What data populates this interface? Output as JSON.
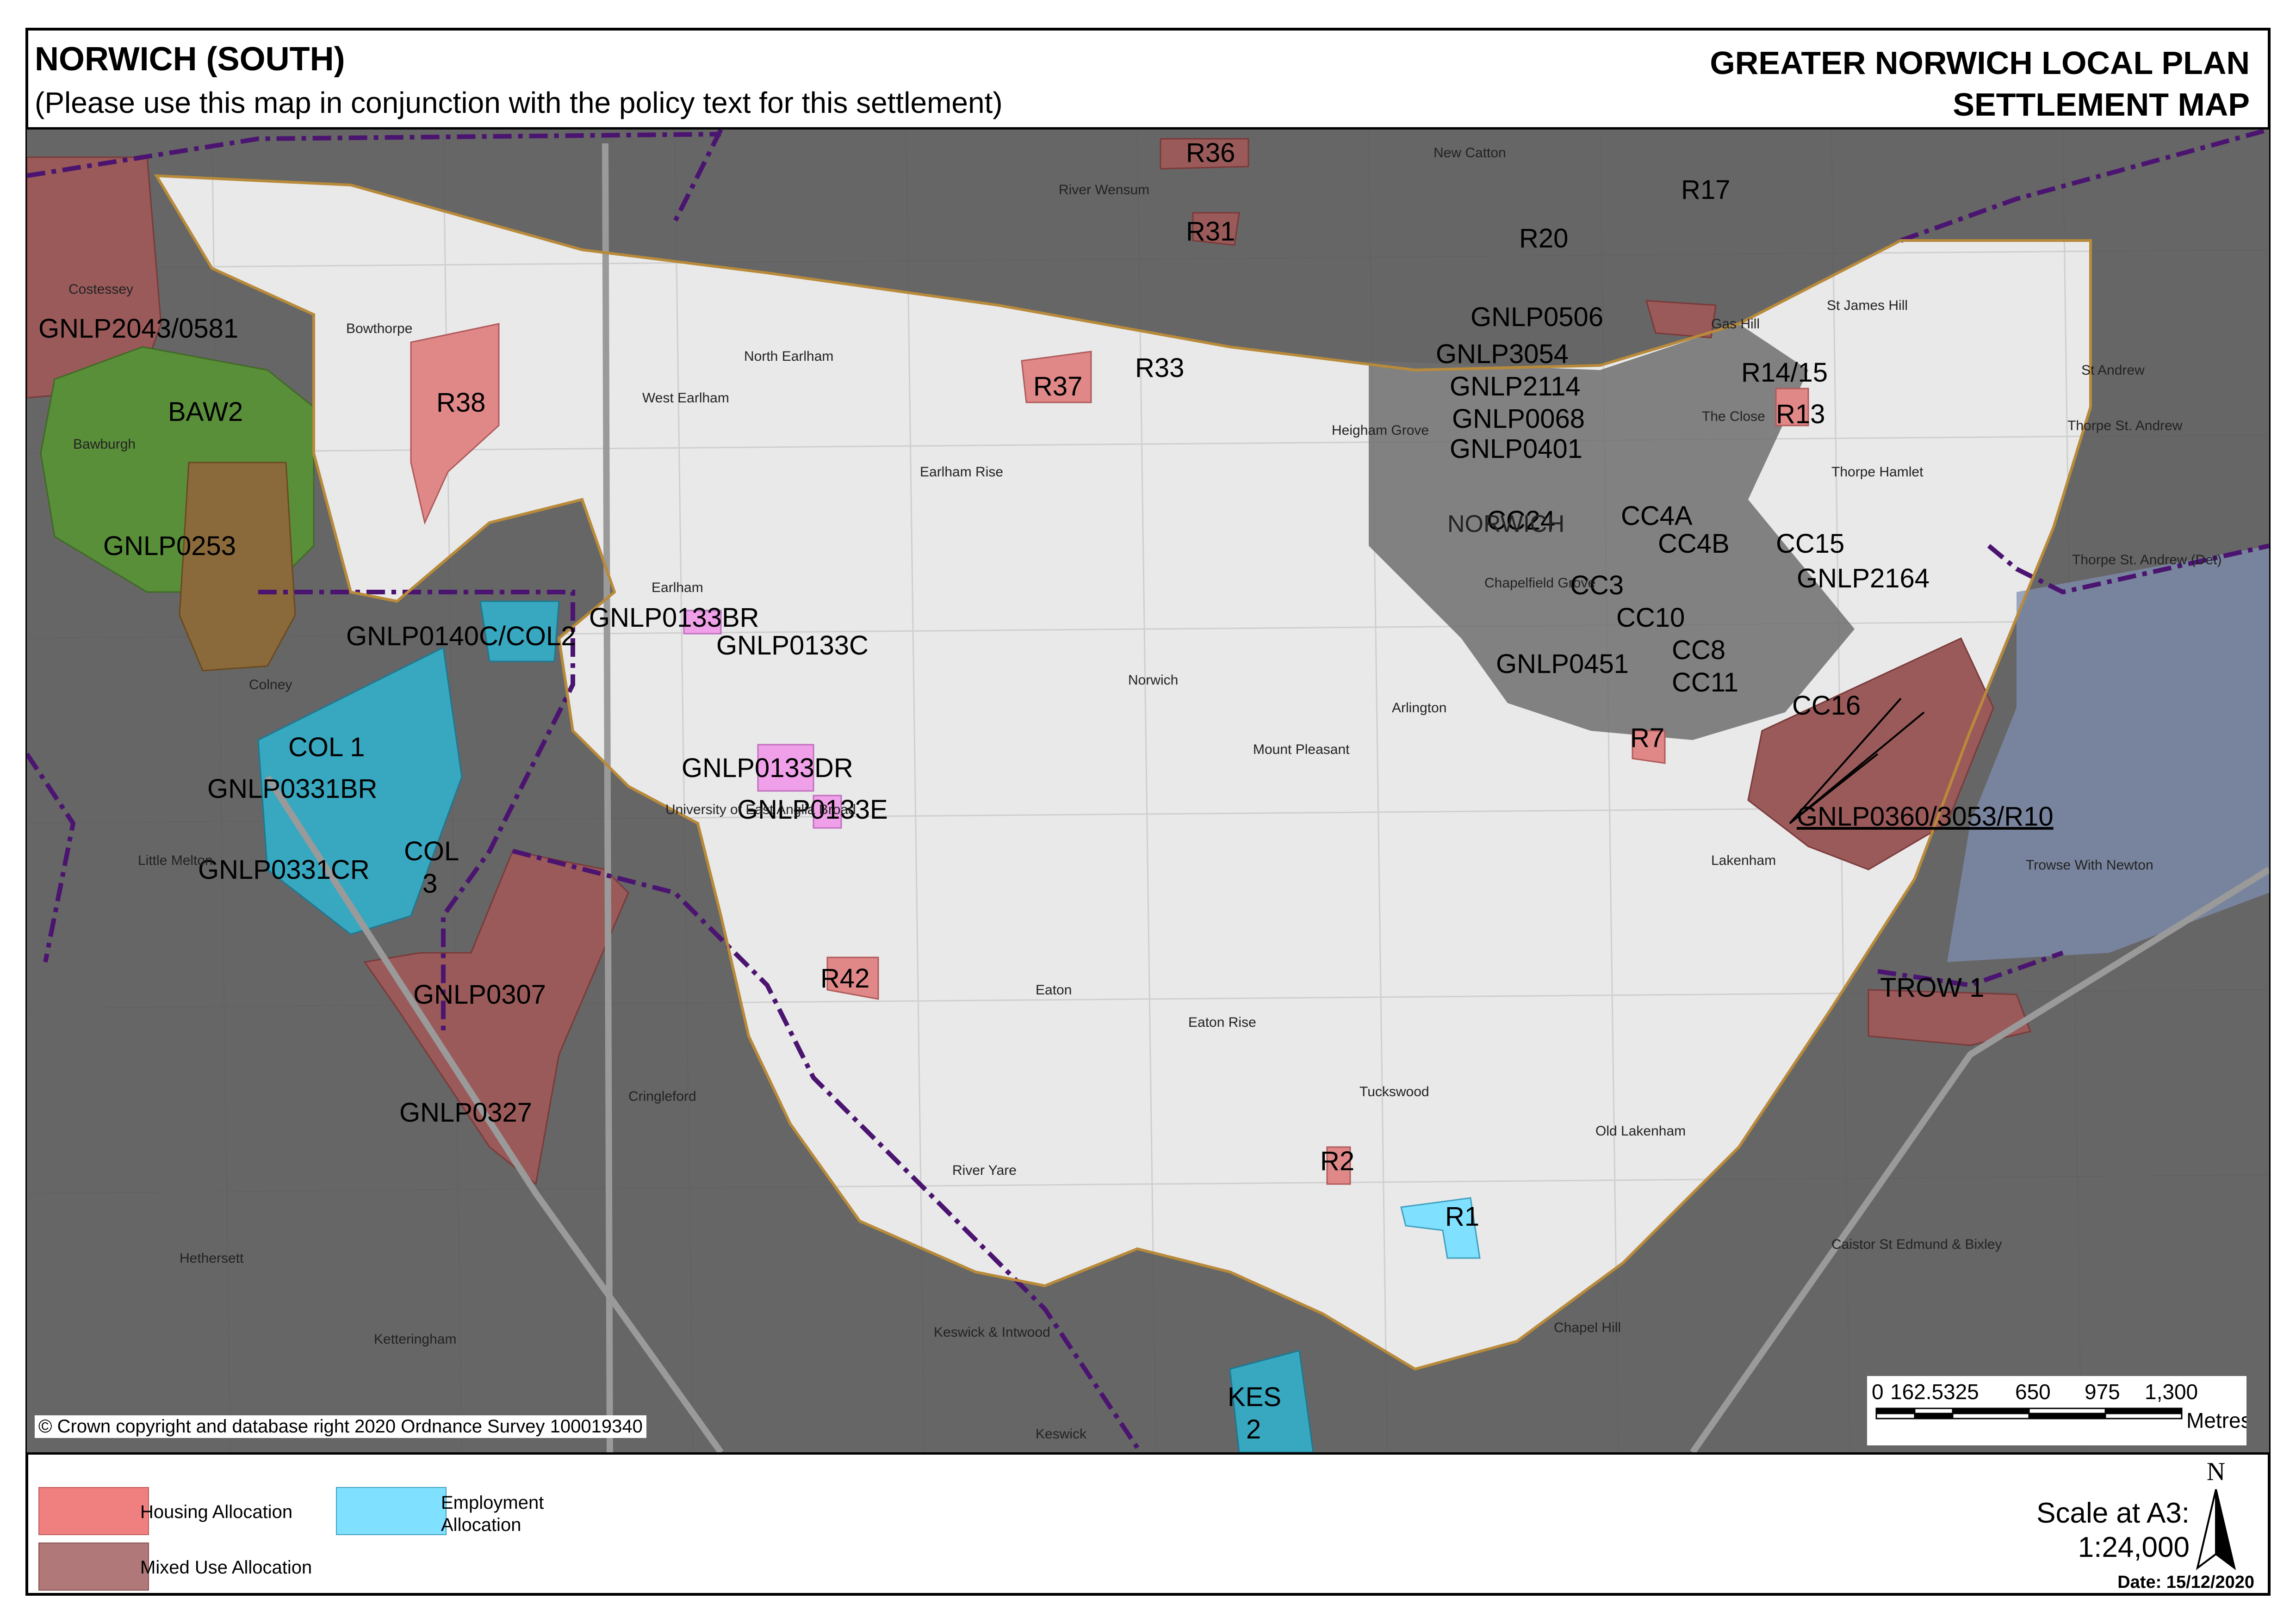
{
  "header": {
    "title": "NORWICH (SOUTH)",
    "subtitle": "(Please use this map in conjunction with the policy text for this settlement)",
    "plan_title_line1": "GREATER NORWICH LOCAL PLAN",
    "plan_title_line2": "SETTLEMENT MAP"
  },
  "map": {
    "copyright": "© Crown copyright and database right 2020 Ordnance Survey 100019340",
    "allocation_labels": [
      "R36",
      "R31",
      "R17",
      "R20",
      "GNLP0506",
      "GNLP3054",
      "GNLP2114",
      "GNLP0068",
      "GNLP0401",
      "R14/15",
      "R13",
      "GNLP2043/0581",
      "BAW2",
      "R38",
      "R37",
      "R33",
      "GNLP0253",
      "CC24",
      "CC4A",
      "CC4B",
      "CC15",
      "GNLP2164",
      "CC3",
      "CC10",
      "CC8",
      "CC11",
      "GNLP0451",
      "GNLP0133BR",
      "GNLP0140C/COL2",
      "GNLP0133C",
      "R7",
      "CC16",
      "COL 1",
      "GNLP0133DR",
      "GNLP0331BR",
      "GNLP0133E",
      "GNLP0360/3053/R10",
      "COL",
      "3",
      "GNLP0331CR",
      "TROW 1",
      "R42",
      "GNLP0307",
      "GNLP0327",
      "R2",
      "R1",
      "KES",
      "2"
    ],
    "place_names": [
      "New Catton",
      "Costessey",
      "Bowthorpe",
      "North Earlham",
      "West Earlham",
      "Bawburgh",
      "Earlham Rise",
      "Heigham Grove",
      "NORWICH",
      "Thorpe Hamlet",
      "Thorpe St. Andrew",
      "Thorpe St. Andrew (Det)",
      "The Close",
      "Chapelfield Grove",
      "Earlham",
      "Norwich",
      "Arlington",
      "Mount Pleasant",
      "Colney",
      "Little Melton",
      "Lakenham",
      "Trowse With Newton",
      "Eaton",
      "Eaton Rise",
      "Cringleford",
      "Tuckswood",
      "Old Lakenham",
      "Hethersett",
      "Ketteringham",
      "Keswick & Intwood",
      "Caistor St Edmund & Bixley",
      "River Yare",
      "River Wensum",
      "Keswick",
      "Chapel Hill",
      "Gas Hill",
      "St James Hill",
      "St Andrew",
      "University of East Anglia Broad"
    ],
    "scale_labels": [
      "0",
      "162.5",
      "325",
      "650",
      "975",
      "1,300"
    ],
    "scale_unit": "Metres"
  },
  "legend": {
    "items": [
      {
        "label": "Housing Allocation",
        "color": "#f08080"
      },
      {
        "label": "Employment Allocation",
        "color": "#80e0ff"
      },
      {
        "label": "Mixed Use Allocation",
        "color": "#b07878"
      }
    ],
    "north_label": "N",
    "scale_line1": "Scale at A3:",
    "scale_line2": "1:24,000",
    "date": "Date: 15/12/2020"
  },
  "colors": {
    "housing": "#f08080",
    "employment": "#80e0ff",
    "mixed_use": "#b07878",
    "outside_area": "#555555",
    "settlement_boundary": "#4b1470"
  }
}
